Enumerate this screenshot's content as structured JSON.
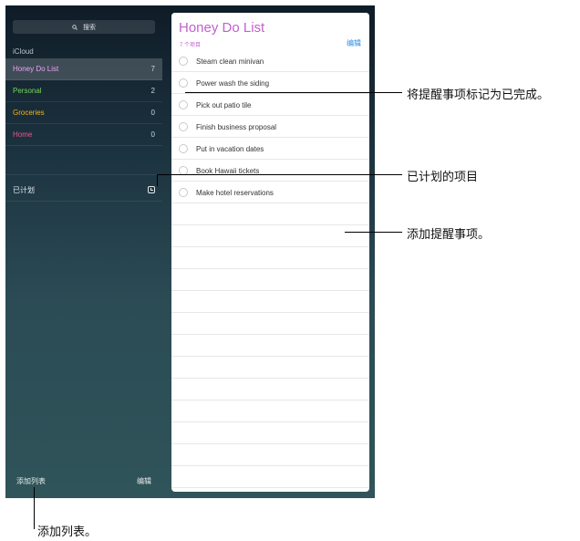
{
  "sidebar": {
    "search_label": "搜索",
    "section_title": "iCloud",
    "lists": [
      {
        "name": "Honey Do List",
        "count": "7",
        "color": "#e7a4f0"
      },
      {
        "name": "Personal",
        "count": "2",
        "color": "#79d85c"
      },
      {
        "name": "Groceries",
        "count": "0",
        "color": "#f2b21b"
      },
      {
        "name": "Home",
        "count": "0",
        "color": "#f2548f"
      }
    ],
    "scheduled_label": "已计划",
    "add_list_label": "添加列表",
    "edit_label": "编辑"
  },
  "list_view": {
    "title": "Honey Do List",
    "item_count_label": "7 个项目",
    "edit_label": "编辑",
    "items": [
      "Steam clean minivan",
      "Power wash the siding",
      "Pick out patio tile",
      "Finish business proposal",
      "Put in vacation dates",
      "Book Hawaii tickets",
      "Make hotel reservations"
    ]
  },
  "callouts": {
    "mark_complete": "将提醒事项标记为已完成。",
    "scheduled_items": "已计划的项目",
    "add_reminder": "添加提醒事项。",
    "add_list": "添加列表。"
  }
}
